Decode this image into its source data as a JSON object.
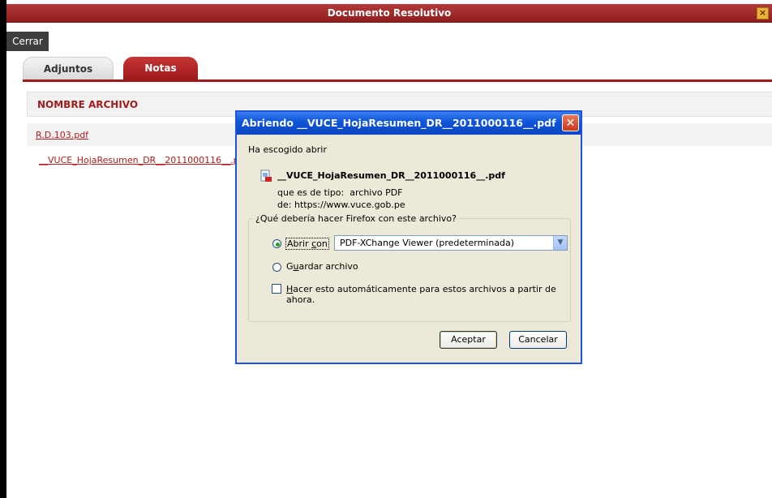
{
  "window": {
    "title": "Documento Resolutivo",
    "close_glyph": "×"
  },
  "toolbar": {
    "close_label": "Cerrar"
  },
  "tabs": [
    {
      "label": "Adjuntos",
      "active": false
    },
    {
      "label": "Notas",
      "active": true
    }
  ],
  "table": {
    "header": "NOMBRE ARCHIVO",
    "rows": [
      {
        "name": "R.D.103.pdf"
      },
      {
        "name": "__VUCE_HojaResumen_DR__2011000116__.pdf"
      }
    ]
  },
  "dialog": {
    "title": "Abriendo __VUCE_HojaResumen_DR__2011000116__.pdf",
    "close_glyph": "✕",
    "intro": "Ha escogido abrir",
    "filename": "__VUCE_HojaResumen_DR__2011000116__.pdf",
    "type_label": "que es de tipo:",
    "type_value": "archivo PDF",
    "from_label": "de:",
    "from_value": "https://www.vuce.gob.pe",
    "group_label": "¿Qué debería hacer Firefox con este archivo?",
    "open_with_label_pre": "Abrir ",
    "open_with_label_key": "c",
    "open_with_label_post": "on",
    "open_with_value": "PDF-XChange Viewer (predeterminada)",
    "save_label_pre": "G",
    "save_label_key": "u",
    "save_label_post": "ardar archivo",
    "auto_label_pre": "",
    "auto_label_key": "H",
    "auto_label_post": "acer esto automáticamente para estos archivos a partir de ahora.",
    "ok_label": "Aceptar",
    "cancel_label": "Cancelar",
    "selected_option": "open"
  },
  "colors": {
    "brand_red": "#9d1b1b",
    "xp_blue": "#0d54d8",
    "dialog_bg": "#ece9d8"
  }
}
